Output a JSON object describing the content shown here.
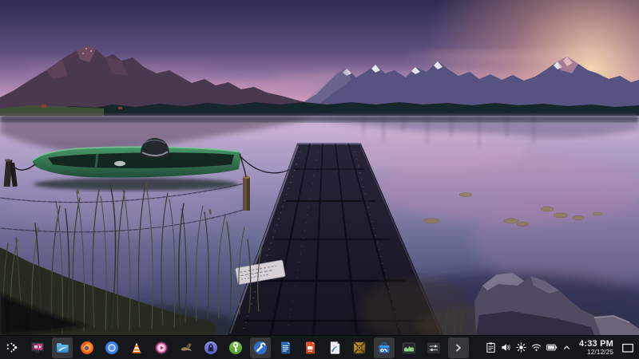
{
  "wallpaper": {
    "description": "Alpine lake at pink-purple sunset: snow-capped mountains, dark wooden dock leading into calm water, green rowboat moored by reeds, rocks at lower right",
    "palette": {
      "sky_top": "#2e2c52",
      "sky_pink": "#d39cc0",
      "sunset_glow": "#ffd6a4",
      "mountains_left": "#4a384e",
      "mountains_right": "#565380",
      "water_top": "#c9b3d6",
      "water_bottom": "#353a5c",
      "boat_green": "#3f8a5c",
      "dock_wood": "#201e2e"
    }
  },
  "taskbar": {
    "background": "#16191c",
    "items": [
      {
        "label": "Application Launcher",
        "icon": "launcher-dots-icon",
        "active": false
      },
      {
        "label": "Display Settings",
        "icon": "monitor-icon",
        "active": false
      },
      {
        "label": "File Manager",
        "icon": "folder-icon",
        "active": true
      },
      {
        "label": "Firefox",
        "icon": "firefox-icon",
        "active": false
      },
      {
        "label": "Chromium",
        "icon": "chromium-icon",
        "active": false
      },
      {
        "label": "VLC Media Player",
        "icon": "vlc-cone-icon",
        "active": false
      },
      {
        "label": "Media Player",
        "icon": "play-circle-icon",
        "active": false
      },
      {
        "label": "Bird App",
        "icon": "bird-icon",
        "active": false
      },
      {
        "label": "Password Safe",
        "icon": "padlock-circle-icon",
        "active": false
      },
      {
        "label": "Key Manager",
        "icon": "key-circle-icon",
        "active": false
      },
      {
        "label": "Tools App",
        "icon": "wrench-circle-icon",
        "active": true
      },
      {
        "label": "Writer Document",
        "icon": "writer-document-icon",
        "active": false
      },
      {
        "label": "Impress Presentation",
        "icon": "impress-document-icon",
        "active": false
      },
      {
        "label": "Draw Document",
        "icon": "draw-document-icon",
        "active": false
      },
      {
        "label": "Game",
        "icon": "gold-emblem-icon",
        "active": false
      },
      {
        "label": "Software Toolbox",
        "icon": "toolbox-icon",
        "active": true
      },
      {
        "label": "System Monitor",
        "icon": "area-chart-icon",
        "active": false
      },
      {
        "label": "Audio Mixer",
        "icon": "sliders-icon",
        "active": false
      },
      {
        "label": "Expand Panel",
        "icon": "chevron-right-icon",
        "active": true
      }
    ],
    "tray": {
      "icons": [
        {
          "label": "Clipboard",
          "icon": "clipboard-icon"
        },
        {
          "label": "Audio Volume",
          "icon": "speaker-icon"
        },
        {
          "label": "Brightness",
          "icon": "sun-icon"
        },
        {
          "label": "Wi-Fi Network",
          "icon": "wifi-icon"
        },
        {
          "label": "Battery",
          "icon": "battery-icon"
        },
        {
          "label": "Expand System Tray",
          "icon": "chevron-up-icon"
        }
      ]
    },
    "clock": {
      "time": "4:33 PM",
      "date": "12/12/25"
    },
    "show_desktop_label": "Show Desktop"
  }
}
